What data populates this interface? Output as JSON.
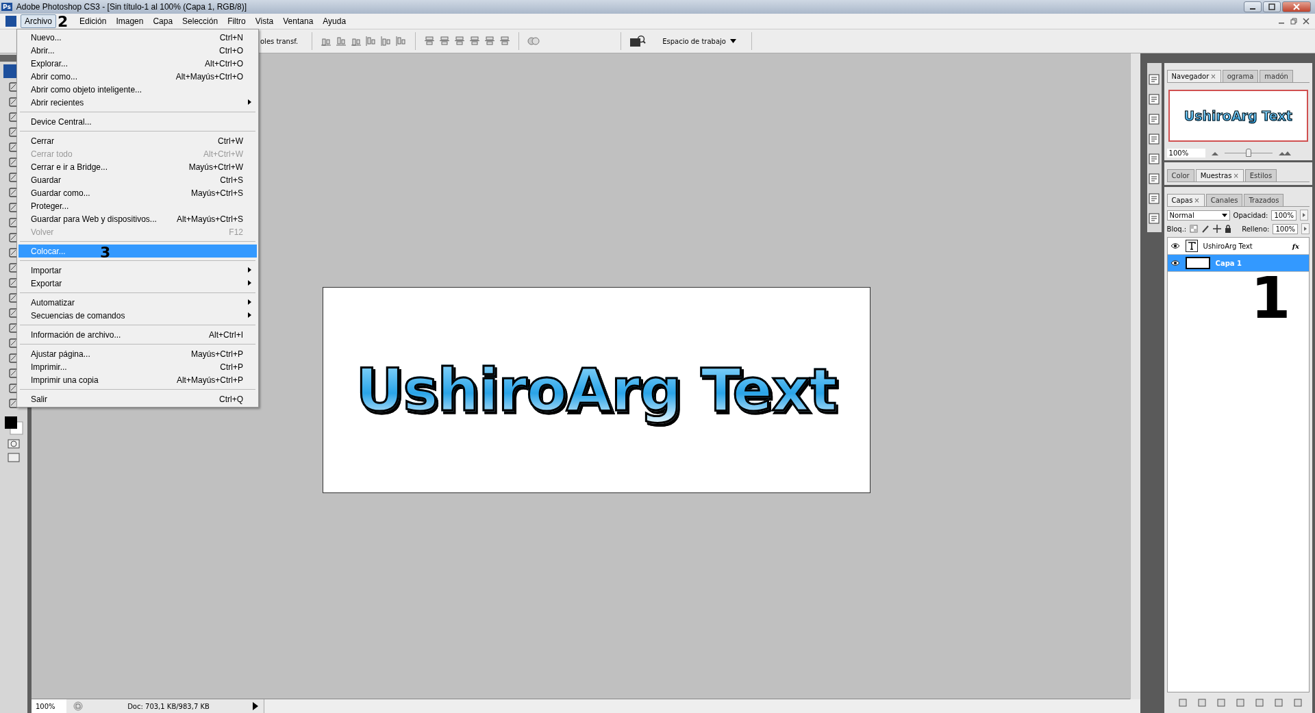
{
  "window": {
    "app_icon": "Ps",
    "title": "Adobe Photoshop CS3 - [Sin título-1 al 100% (Capa 1, RGB/8)]"
  },
  "menu_bar": [
    {
      "label": "Archivo",
      "selected": true
    },
    {
      "label": "Edición",
      "selected": false
    },
    {
      "label": "Imagen",
      "selected": false
    },
    {
      "label": "Capa",
      "selected": false
    },
    {
      "label": "Selección",
      "selected": false
    },
    {
      "label": "Filtro",
      "selected": false
    },
    {
      "label": "Vista",
      "selected": false
    },
    {
      "label": "Ventana",
      "selected": false
    },
    {
      "label": "Ayuda",
      "selected": false
    }
  ],
  "file_menu": [
    {
      "kind": "item",
      "label": "Nuevo...",
      "shortcut": "Ctrl+N",
      "disabled": false,
      "selected": false,
      "submenu": false
    },
    {
      "kind": "item",
      "label": "Abrir...",
      "shortcut": "Ctrl+O",
      "disabled": false,
      "selected": false,
      "submenu": false
    },
    {
      "kind": "item",
      "label": "Explorar...",
      "shortcut": "Alt+Ctrl+O",
      "disabled": false,
      "selected": false,
      "submenu": false
    },
    {
      "kind": "item",
      "label": "Abrir como...",
      "shortcut": "Alt+Mayús+Ctrl+O",
      "disabled": false,
      "selected": false,
      "submenu": false
    },
    {
      "kind": "item",
      "label": "Abrir como objeto inteligente...",
      "disabled": false,
      "selected": false,
      "submenu": false
    },
    {
      "kind": "item",
      "label": "Abrir recientes",
      "disabled": false,
      "selected": false,
      "submenu": true
    },
    {
      "kind": "separator"
    },
    {
      "kind": "item",
      "label": "Device Central...",
      "disabled": false,
      "selected": false,
      "submenu": false
    },
    {
      "kind": "separator"
    },
    {
      "kind": "item",
      "label": "Cerrar",
      "shortcut": "Ctrl+W",
      "disabled": false,
      "selected": false,
      "submenu": false
    },
    {
      "kind": "item",
      "label": "Cerrar todo",
      "shortcut": "Alt+Ctrl+W",
      "disabled": true,
      "selected": false,
      "submenu": false
    },
    {
      "kind": "item",
      "label": "Cerrar e ir a Bridge...",
      "shortcut": "Mayús+Ctrl+W",
      "disabled": false,
      "selected": false,
      "submenu": false
    },
    {
      "kind": "item",
      "label": "Guardar",
      "shortcut": "Ctrl+S",
      "disabled": false,
      "selected": false,
      "submenu": false
    },
    {
      "kind": "item",
      "label": "Guardar como...",
      "shortcut": "Mayús+Ctrl+S",
      "disabled": false,
      "selected": false,
      "submenu": false
    },
    {
      "kind": "item",
      "label": "Proteger...",
      "disabled": false,
      "selected": false,
      "submenu": false
    },
    {
      "kind": "item",
      "label": "Guardar para Web y dispositivos...",
      "shortcut": "Alt+Mayús+Ctrl+S",
      "disabled": false,
      "selected": false,
      "submenu": false
    },
    {
      "kind": "item",
      "label": "Volver",
      "shortcut": "F12",
      "disabled": true,
      "selected": false,
      "submenu": false
    },
    {
      "kind": "separator"
    },
    {
      "kind": "item",
      "label": "Colocar...",
      "disabled": false,
      "selected": true,
      "submenu": false
    },
    {
      "kind": "separator"
    },
    {
      "kind": "item",
      "label": "Importar",
      "disabled": false,
      "selected": false,
      "submenu": true
    },
    {
      "kind": "item",
      "label": "Exportar",
      "disabled": false,
      "selected": false,
      "submenu": true
    },
    {
      "kind": "separator"
    },
    {
      "kind": "item",
      "label": "Automatizar",
      "disabled": false,
      "selected": false,
      "submenu": true
    },
    {
      "kind": "item",
      "label": "Secuencias de comandos",
      "disabled": false,
      "selected": false,
      "submenu": true
    },
    {
      "kind": "separator"
    },
    {
      "kind": "item",
      "label": "Información de archivo...",
      "shortcut": "Alt+Ctrl+I",
      "disabled": false,
      "selected": false,
      "submenu": false
    },
    {
      "kind": "separator"
    },
    {
      "kind": "item",
      "label": "Ajustar página...",
      "shortcut": "Mayús+Ctrl+P",
      "disabled": false,
      "selected": false,
      "submenu": false
    },
    {
      "kind": "item",
      "label": "Imprimir...",
      "shortcut": "Ctrl+P",
      "disabled": false,
      "selected": false,
      "submenu": false
    },
    {
      "kind": "item",
      "label": "Imprimir una copia",
      "shortcut": "Alt+Mayús+Ctrl+P",
      "disabled": false,
      "selected": false,
      "submenu": false
    },
    {
      "kind": "separator"
    },
    {
      "kind": "item",
      "label": "Salir",
      "shortcut": "Ctrl+Q",
      "disabled": false,
      "selected": false,
      "submenu": false
    }
  ],
  "options_bar": {
    "partial_label": "oles transf.",
    "workspace_button": "Espacio de trabajo"
  },
  "document": {
    "text": "UshiroArg Text"
  },
  "navigator": {
    "tabs": [
      {
        "label": "Navegador",
        "close": "×",
        "selected": true
      },
      {
        "label": "ograma",
        "selected": false
      },
      {
        "label": "madón",
        "selected": false
      }
    ],
    "preview_text": "UshiroArg Text",
    "zoom": "100%",
    "level": 0.5
  },
  "color_panel": {
    "tabs": [
      {
        "label": "Color",
        "selected": false
      },
      {
        "label": "Muestras",
        "close": "×",
        "selected": true
      },
      {
        "label": "Estilos",
        "selected": false
      }
    ]
  },
  "layers_panel": {
    "tabs": [
      {
        "label": "Capas",
        "close": "×",
        "selected": true
      },
      {
        "label": "Canales",
        "selected": false
      },
      {
        "label": "Trazados",
        "selected": false
      }
    ],
    "blend_mode": "Normal",
    "opacity_label": "Opacidad:",
    "opacity": "100%",
    "lock_label": "Bloq.:",
    "fill_label": "Relleno:",
    "fill": "100%",
    "layers": [
      {
        "name": "UshiroArg Text",
        "kind": "text",
        "effects": "fx",
        "selected": false
      },
      {
        "name": "Capa 1",
        "kind": "pixel",
        "selected": true
      }
    ]
  },
  "status_bar": {
    "zoom": "100%",
    "doc_info": "Doc: 703,1 KB/983,7 KB"
  },
  "annotations": [
    {
      "label": "2"
    },
    {
      "label": "3"
    },
    {
      "label": "1"
    }
  ]
}
